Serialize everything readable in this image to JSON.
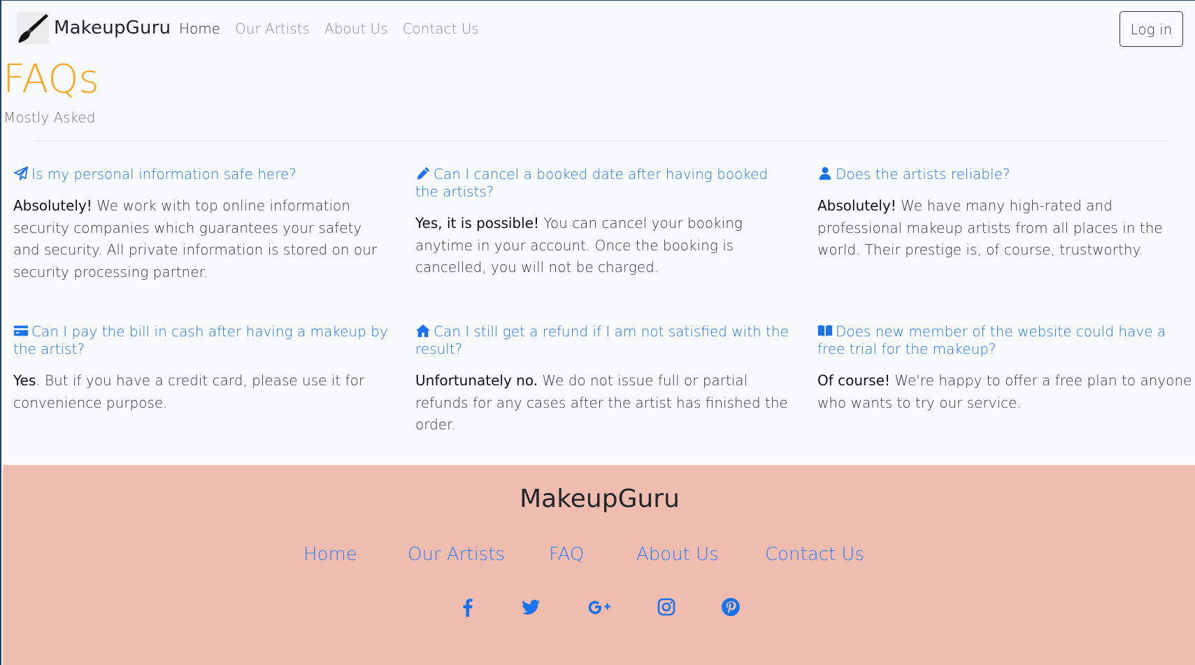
{
  "header": {
    "brand": "MakeupGuru",
    "nav": [
      "Home",
      "Our Artists",
      "About Us",
      "Contact Us"
    ],
    "login_label": "Log in"
  },
  "heading": {
    "title": "FAQs",
    "subtitle": "Mostly Asked"
  },
  "faqs": [
    {
      "icon": "paper-plane-icon",
      "question": "Is my personal information safe here?",
      "answer_bold": "Absolutely!",
      "answer": " We work with top online information security companies which guarantees your safety and security. All private information is stored on our security processing partner."
    },
    {
      "icon": "pencil-icon",
      "question": "Can I cancel a booked date after having booked the artists?",
      "answer_bold": "Yes, it is possible!",
      "answer": " You can cancel your booking anytime in your account. Once the booking is cancelled, you will not be charged."
    },
    {
      "icon": "user-icon",
      "question": "Does the artists reliable?",
      "answer_bold": "Absolutely!",
      "answer": " We have many high-rated and professional makeup artists from all places in the world. Their prestige is, of course, trustworthy."
    },
    {
      "icon": "credit-card-icon",
      "question": "Can I pay the bill in cash after having a makeup by the artist?",
      "answer_bold": "Yes",
      "answer": ". But if you have a credit card, please use it for convenience purpose."
    },
    {
      "icon": "home-icon",
      "question": "Can I still get a refund if I am not satisfied with the result?",
      "answer_bold": "Unfortunately no.",
      "answer": " We do not issue full or partial refunds for any cases after the artist has finished the order."
    },
    {
      "icon": "book-icon",
      "question": "Does new member of the website could have a free trial for the makeup?",
      "answer_bold": "Of course!",
      "answer": " We're happy to offer a free plan to anyone who wants to try our service."
    }
  ],
  "footer": {
    "brand": "MakeupGuru",
    "links": [
      "Home",
      "Our Artists",
      "FAQ",
      "About Us",
      "Contact Us"
    ],
    "socials": [
      "facebook-icon",
      "twitter-icon",
      "google-plus-icon",
      "instagram-icon",
      "pinterest-icon"
    ]
  },
  "colors": {
    "accent": "#f6a623",
    "link": "#1a73e8",
    "footer_bg": "#efbcb0",
    "footer_link": "#2f7df6"
  }
}
